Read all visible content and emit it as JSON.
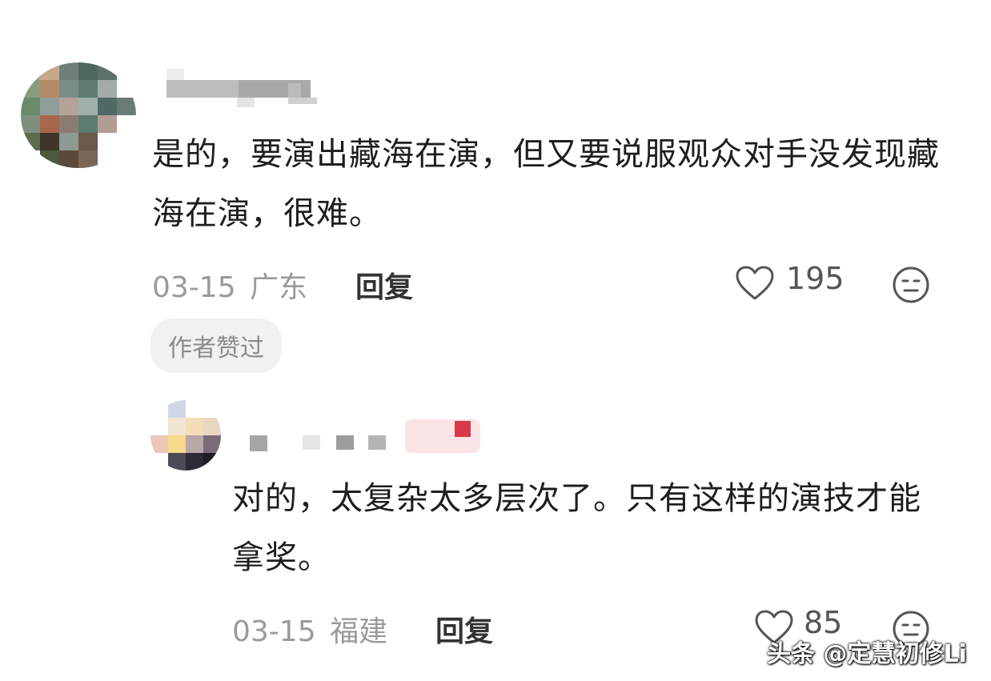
{
  "comments": [
    {
      "text": "是的，要演出藏海在演，但又要说服观众对手没发现藏海在演，很难。",
      "date": "03-15",
      "location": "广东",
      "reply_label": "回复",
      "likes": "195",
      "badge": "作者赞过"
    },
    {
      "text": "对的，太复杂太多层次了。只有这样的演技才能拿奖。",
      "date": "03-15",
      "location": "福建",
      "reply_label": "回复",
      "likes": "85"
    }
  ],
  "watermark": "头条 @定慧初修Li",
  "icons": {
    "like": "heart-outline-icon",
    "reaction": "neutral-face-icon"
  },
  "colors": {
    "text": "#1e1e1e",
    "meta": "#9a9a9a",
    "badge_bg": "#f1f1f1",
    "accent_red": "#d9384a"
  }
}
